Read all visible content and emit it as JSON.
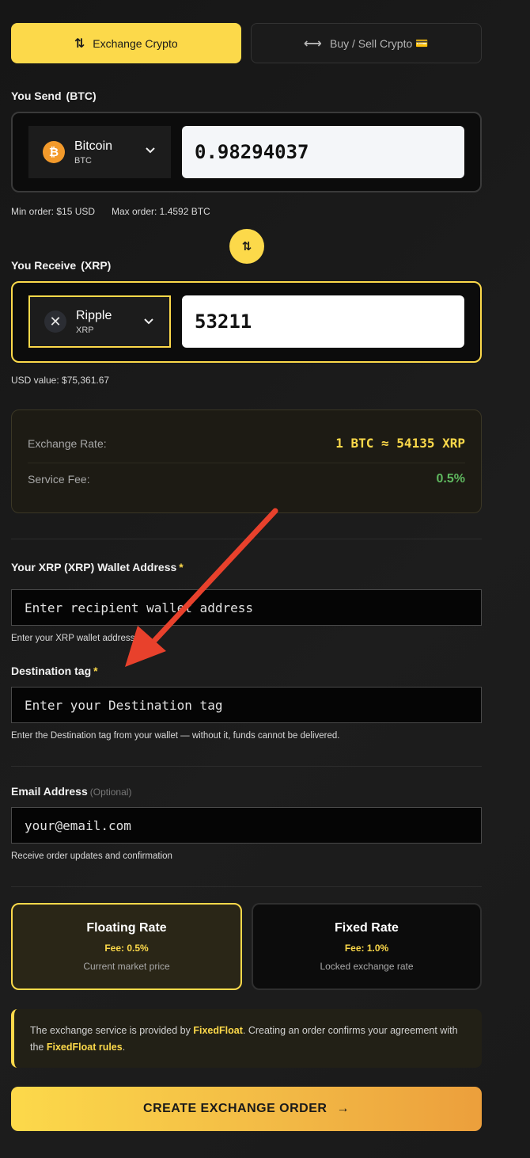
{
  "tabs": {
    "exchange": {
      "icon": "⇅",
      "label": "Exchange Crypto"
    },
    "buysell": {
      "icon": "⟷",
      "label": "Buy / Sell Crypto",
      "card_icon": "💳"
    }
  },
  "send": {
    "label": "You Send",
    "symbol_tag": "(BTC)",
    "coin_name": "Bitcoin",
    "coin_symbol": "BTC",
    "coin_icon": "₿",
    "amount": "0.98294037",
    "min_order": "Min order: $15 USD",
    "max_order": "Max order: 1.4592 BTC"
  },
  "swap_icon": "⇅",
  "receive": {
    "label": "You Receive",
    "symbol_tag": "(XRP)",
    "coin_name": "Ripple",
    "coin_symbol": "XRP",
    "coin_icon": "✕",
    "amount": "53211",
    "usd_value": "USD value: $75,361.67"
  },
  "rate": {
    "exchange_label": "Exchange Rate:",
    "exchange_value": "1 BTC ≈ 54135 XRP",
    "fee_label": "Service Fee:",
    "fee_value": "0.5%"
  },
  "wallet": {
    "label": "Your XRP (XRP) Wallet Address",
    "required": "*",
    "placeholder": "Enter recipient wallet address",
    "hint": "Enter your XRP wallet address"
  },
  "dest_tag": {
    "label": "Destination tag",
    "required": "*",
    "placeholder": "Enter your Destination tag",
    "hint": "Enter the Destination tag from your wallet — without it, funds cannot be delivered."
  },
  "email": {
    "label": "Email Address",
    "optional": "(Optional)",
    "placeholder": "your@email.com",
    "hint": "Receive order updates and confirmation"
  },
  "rate_options": {
    "floating": {
      "title": "Floating Rate",
      "fee": "Fee: 0.5%",
      "desc": "Current market price"
    },
    "fixed": {
      "title": "Fixed Rate",
      "fee": "Fee: 1.0%",
      "desc": "Locked exchange rate"
    }
  },
  "disclaimer": {
    "p1": "The exchange service is provided by ",
    "brand": "FixedFloat",
    "p2": ". Creating an order confirms your agreement with the ",
    "rules": "FixedFloat rules",
    "p3": "."
  },
  "cta": {
    "label": "CREATE EXCHANGE ORDER",
    "icon": "→"
  },
  "colors": {
    "accent": "#fcd94a",
    "success": "#5fb85f",
    "annotation": "#e8412c"
  }
}
